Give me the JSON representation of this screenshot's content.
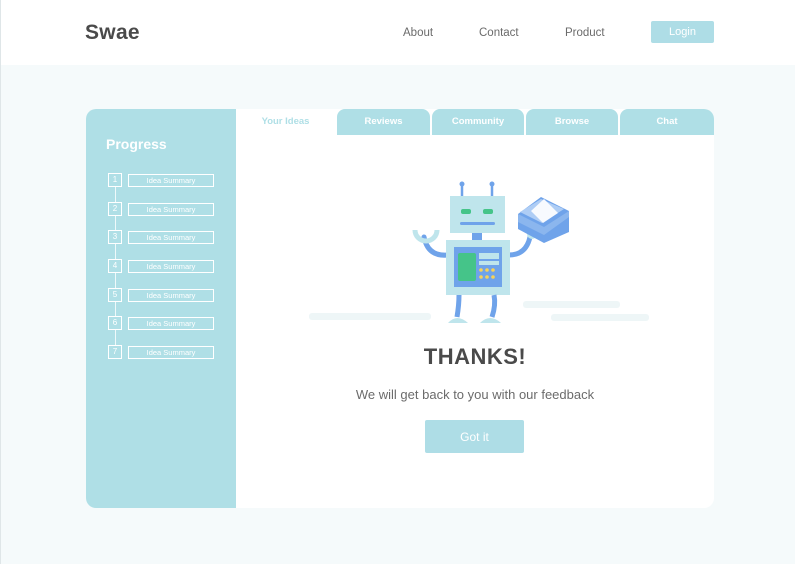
{
  "header": {
    "brand": "Swae",
    "nav": [
      "About",
      "Contact",
      "Product"
    ],
    "login_label": "Login"
  },
  "sidebar": {
    "title": "Progress",
    "steps": [
      {
        "number": "1",
        "label": "Idea Summary"
      },
      {
        "number": "2",
        "label": "Idea Summary"
      },
      {
        "number": "3",
        "label": "Idea Summary"
      },
      {
        "number": "4",
        "label": "Idea Summary"
      },
      {
        "number": "5",
        "label": "Idea Summary"
      },
      {
        "number": "6",
        "label": "Idea Summary"
      },
      {
        "number": "7",
        "label": "Idea Summary"
      }
    ]
  },
  "tabs": [
    {
      "label": "Your Ideas",
      "active": true
    },
    {
      "label": "Reviews",
      "active": false
    },
    {
      "label": "Community",
      "active": false
    },
    {
      "label": "Browse",
      "active": false
    },
    {
      "label": "Chat",
      "active": false
    }
  ],
  "main": {
    "title": "THANKS!",
    "message": "We will get back to you with our feedback",
    "button_label": "Got it"
  },
  "colors": {
    "accent": "#afdfe6",
    "text_dark": "#4a4a4a",
    "robot_blue": "#6fa3ea"
  }
}
